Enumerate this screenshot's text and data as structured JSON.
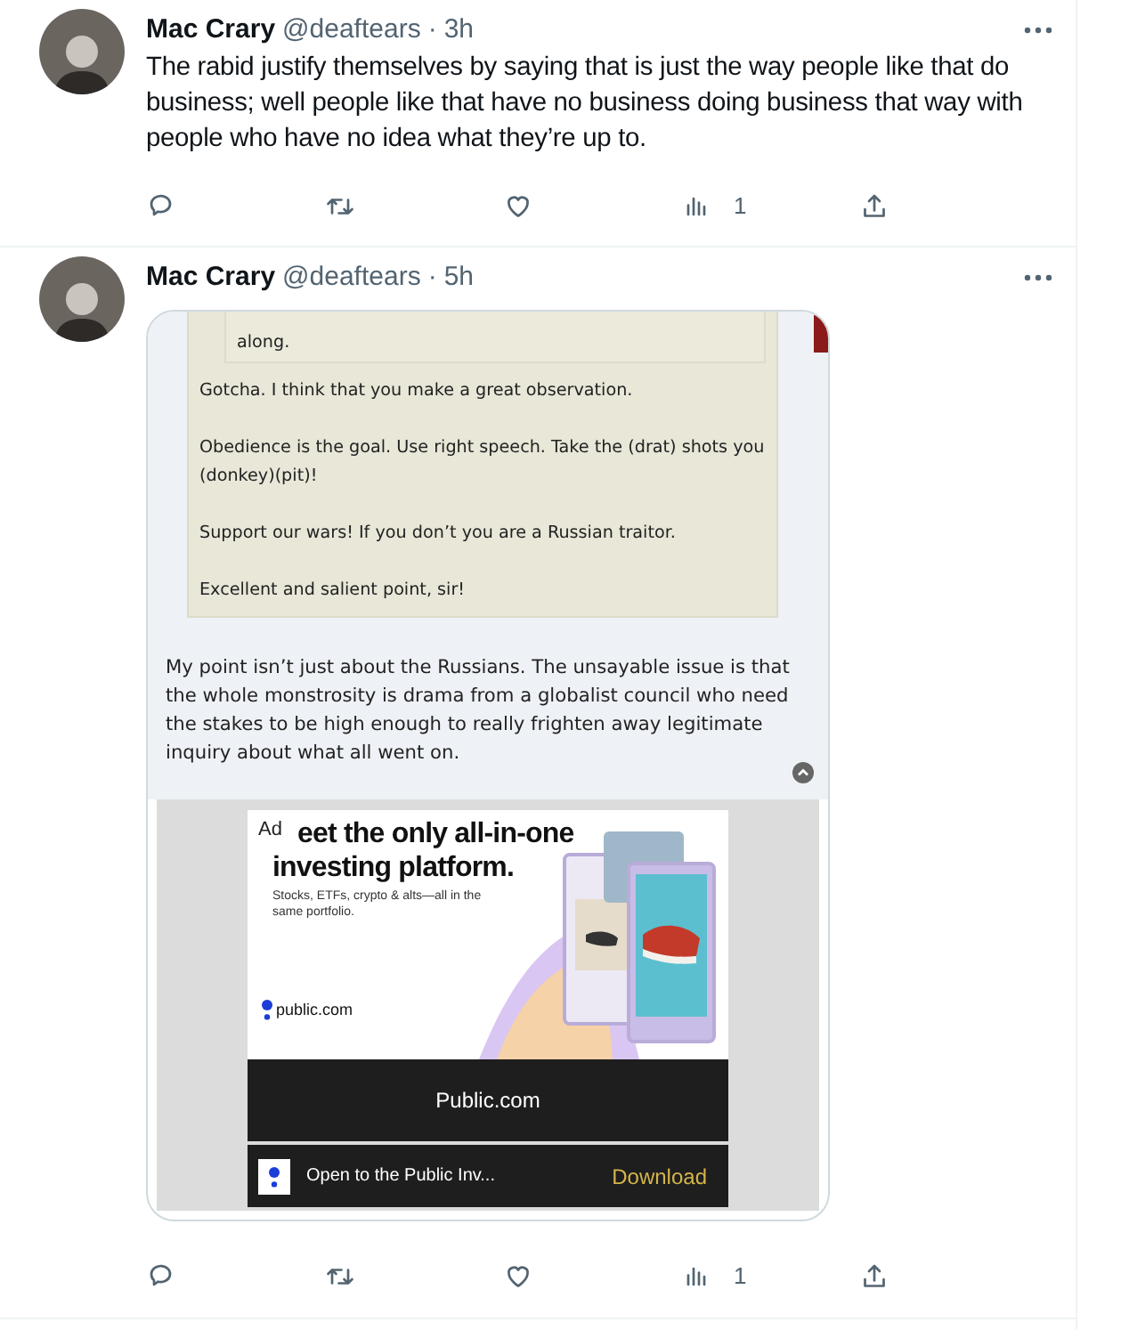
{
  "tweets": [
    {
      "author": "Mac Crary",
      "handle": "@deaftears",
      "separator": "·",
      "time": "3h",
      "text": "The rabid justify themselves by saying that is just the way people like that do business; well people like that have no business doing business that way with people who have no idea what they’re up to.",
      "actions": [
        {
          "kind": "reply"
        },
        {
          "kind": "retweet"
        },
        {
          "kind": "like"
        },
        {
          "kind": "views",
          "count": "1"
        },
        {
          "kind": "share"
        }
      ]
    },
    {
      "author": "Mac Crary",
      "handle": "@deaftears",
      "separator": "·",
      "time": "5h",
      "media": {
        "quote_lines": [
          "along."
        ],
        "replies": [
          "Gotcha. I think that you make a great observation.",
          "Obedience is the goal. Use right speech. Take the (drat) shots you (donkey)(pit)!",
          "Support our wars! If you don’t you are a Russian traitor.",
          "Excellent and salient point, sir!"
        ],
        "body": "My point isn’t just about the Russians. The unsayable issue is that the whole monstrosity is drama from a globalist council who need the stakes to be high enough to really frighten away legitimate inquiry about what all went on.",
        "ad": {
          "label": "Ad",
          "headline": [
            "eet the only all-in-one",
            "investing platform."
          ],
          "subline": "Stocks, ETFs, crypto & alts—all in the same portfolio.",
          "brand": "public.com",
          "title": "Public.com",
          "app_text": "Open to the Public Inv...",
          "cta": "Download"
        }
      },
      "actions": [
        {
          "kind": "reply"
        },
        {
          "kind": "retweet"
        },
        {
          "kind": "like"
        },
        {
          "kind": "views",
          "count": "1"
        },
        {
          "kind": "share"
        }
      ]
    }
  ]
}
